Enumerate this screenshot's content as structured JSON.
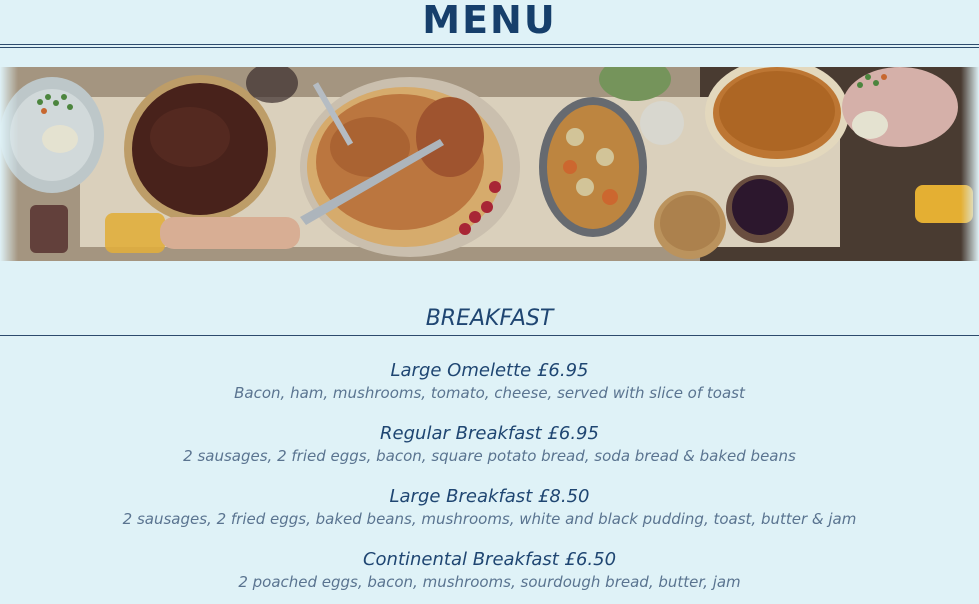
{
  "header": {
    "title": "MENU"
  },
  "banner": {
    "alt": "Holiday roast table with turkey, pie and side dishes"
  },
  "section": {
    "title": "BREAKFAST"
  },
  "items": [
    {
      "name": "Large Omelette",
      "price": "£6.95",
      "label": "Large Omelette £6.95",
      "description": "Bacon, ham, mushrooms, tomato, cheese, served with slice of toast"
    },
    {
      "name": "Regular Breakfast",
      "price": "£6.95",
      "label": "Regular Breakfast £6.95",
      "description": "2 sausages, 2 fried eggs, bacon, square potato bread, soda bread & baked beans"
    },
    {
      "name": "Large Breakfast",
      "price": "£8.50",
      "label": "Large Breakfast £8.50",
      "description": "2 sausages, 2 fried eggs, baked beans, mushrooms, white and black pudding, toast, butter & jam"
    },
    {
      "name": "Continental Breakfast",
      "price": "£6.50",
      "label": "Continental Breakfast £6.50",
      "description": "2 poached eggs, bacon, mushrooms, sourdough bread, butter, jam"
    }
  ],
  "colors": {
    "background": "#dff2f7",
    "heading": "#163f6b",
    "text": "#1f4672",
    "muted": "#5a7490"
  }
}
